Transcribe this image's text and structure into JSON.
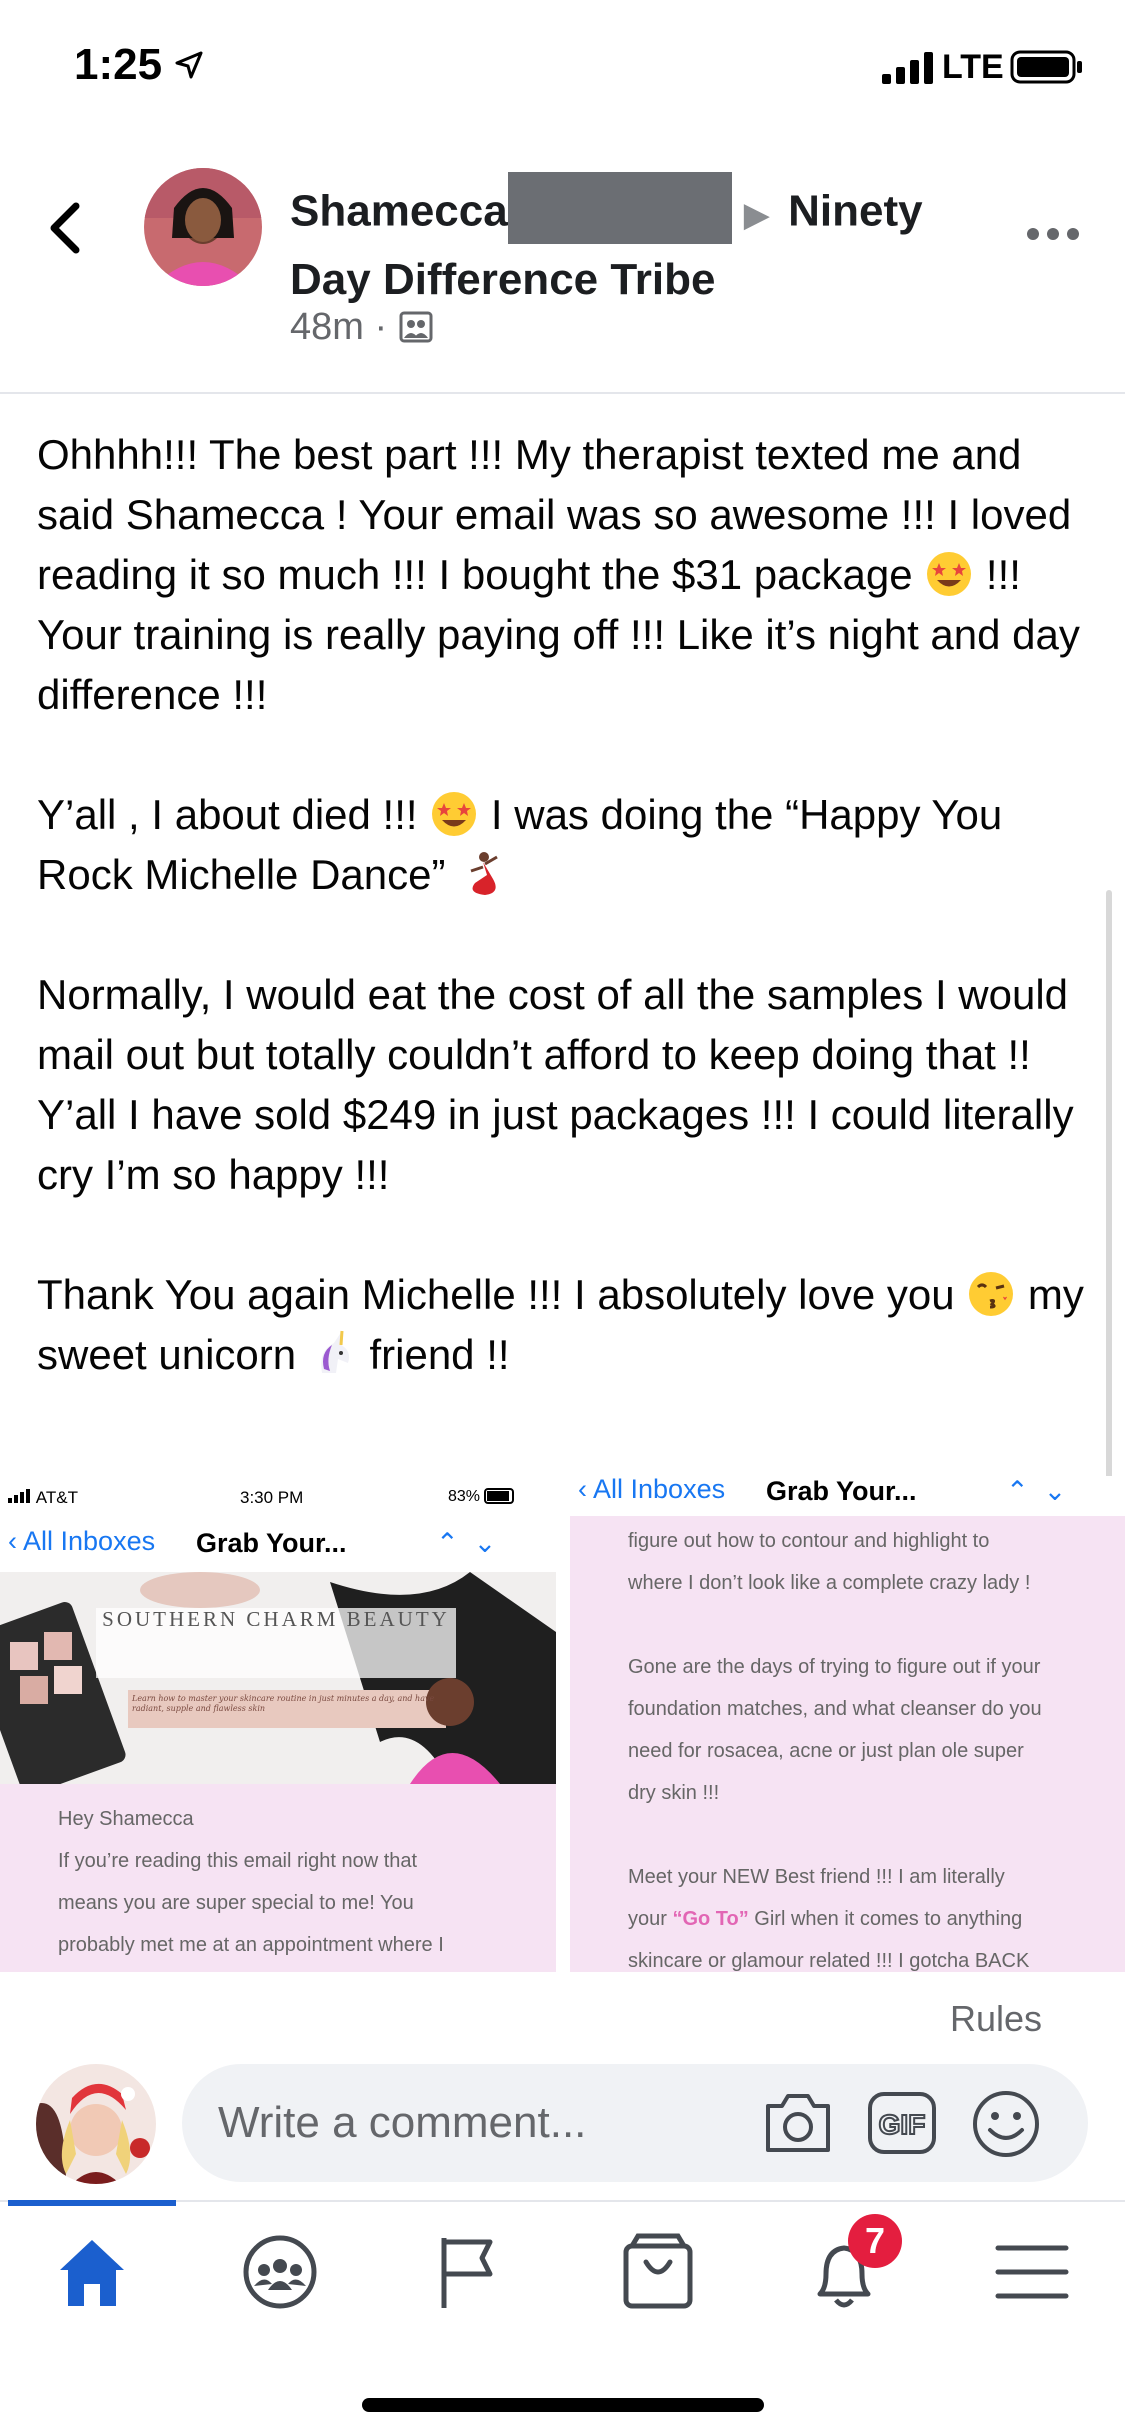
{
  "status_bar": {
    "time": "1:25",
    "network": "LTE"
  },
  "header": {
    "author": "Shamecca",
    "group": "Ninety Day Difference Tribe",
    "timestamp": "48m",
    "separator": "·"
  },
  "post": {
    "paragraphs": [
      {
        "parts": [
          "Ohhhh!!! The best part !!! My therapist texted me and said Shamecca ! Your email was so awesome !!! I loved reading it so much !!! I bought the $31 package ",
          " !!! Your training is really paying off !!! Like it’s night and day difference !!!"
        ]
      },
      {
        "parts": [
          "Y’all , I about died !!! ",
          " I was doing the “Happy You Rock Michelle Dance” "
        ]
      },
      {
        "parts": [
          "Normally, I would eat the cost of all the samples I would mail out but totally couldn’t afford to keep doing that !! Y’all I have sold $249 in just packages !!! I could literally cry I’m so happy !!!"
        ]
      },
      {
        "parts": [
          "Thank You again Michelle !!! I absolutely love you ",
          " my sweet unicorn ",
          " friend !!"
        ]
      }
    ],
    "emojis": [
      "star-struck-emoji",
      "star-struck-emoji",
      "dancer-emoji",
      "kiss-emoji",
      "unicorn-emoji"
    ]
  },
  "attachment_1": {
    "carrier": "AT&T",
    "time": "3:30 PM",
    "battery": "83%",
    "back_label": "All Inboxes",
    "subject": "Grab Your...",
    "banner_title": "SOUTHERN CHARM BEAUTY",
    "banner_tagline": "Learn how to master your skincare routine in just minutes a day, and have radiant, supple and flawless skin",
    "greeting": "Hey Shamecca",
    "body": [
      "If you’re reading this email right now that",
      "means you are super special to me! You",
      "probably met me at an appointment where I"
    ]
  },
  "attachment_2": {
    "back_label": "All Inboxes",
    "subject": "Grab Your...",
    "lines": [
      "figure out how to contour and highlight to",
      "where I don’t look like a complete crazy lady !",
      "",
      "Gone are the days of trying to figure out if your",
      "foundation matches, and what cleanser do you",
      "need for rosacea, acne or just plan ole super",
      "dry skin !!!",
      "",
      "Meet your NEW Best friend !!! I am literally",
      "your “Go To” Girl when it comes to anything",
      "skincare or glamour related !!! I gotcha BACK"
    ],
    "highlight": "“Go To”"
  },
  "rules_label": "Rules",
  "comment": {
    "placeholder": "Write a comment..."
  },
  "nav": {
    "notifications_count": "7",
    "active_tab": "home"
  },
  "colors": {
    "accent": "#1b5fce",
    "badge": "#e41e3f",
    "pink_bg": "#f6e3f3",
    "link": "#1877f2"
  }
}
